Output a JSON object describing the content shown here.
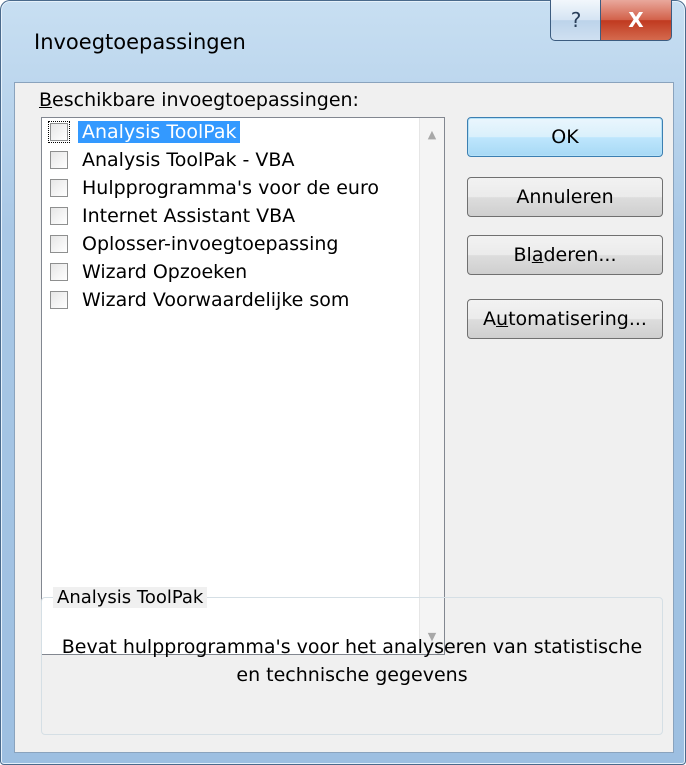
{
  "window": {
    "title": "Invoegtoepassingen",
    "help_glyph": "?",
    "close_glyph": "X"
  },
  "addins": {
    "label_accel": "B",
    "label_rest": "eschikbare invoegtoepassingen:",
    "items": [
      {
        "label": "Analysis ToolPak",
        "checked": false,
        "selected": true
      },
      {
        "label": "Analysis ToolPak - VBA",
        "checked": false,
        "selected": false
      },
      {
        "label": "Hulpprogramma's voor de euro",
        "checked": false,
        "selected": false
      },
      {
        "label": "Internet Assistant VBA",
        "checked": false,
        "selected": false
      },
      {
        "label": "Oplosser-invoegtoepassing",
        "checked": false,
        "selected": false
      },
      {
        "label": "Wizard Opzoeken",
        "checked": false,
        "selected": false
      },
      {
        "label": "Wizard Voorwaardelijke som",
        "checked": false,
        "selected": false
      }
    ]
  },
  "buttons": {
    "ok": "OK",
    "cancel": "Annuleren",
    "browse_pre": "Bl",
    "browse_accel": "a",
    "browse_post": "deren...",
    "automation_pre": "A",
    "automation_accel": "u",
    "automation_post": "tomatisering..."
  },
  "description": {
    "title": "Analysis ToolPak",
    "text": "Bevat hulpprogramma's voor het analyseren van statistische en technische gegevens"
  },
  "colors": {
    "selection": "#3399ff",
    "dialog_bg": "#f0f0f0",
    "close_button": "#c0391f"
  }
}
